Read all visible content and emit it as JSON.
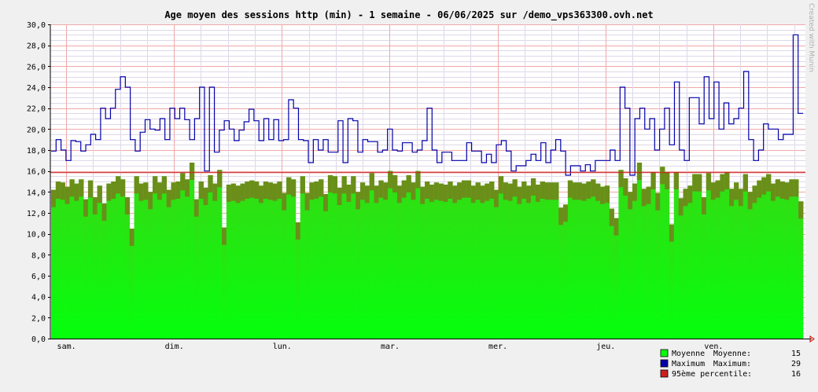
{
  "chart_data": {
    "type": "bar",
    "title": "Age moyen des sessions http (min) - 1 semaine - 06/06/2025 sur /demo_vps363300.ovh.net",
    "watermark": "Created with Munin",
    "xlabel": "",
    "ylabel": "",
    "ylim": [
      0,
      30
    ],
    "y_ticks": [
      "0,0",
      "2,0",
      "4,0",
      "6,0",
      "8,0",
      "10,0",
      "12,0",
      "14,0",
      "16,0",
      "18,0",
      "20,0",
      "22,0",
      "24,0",
      "26,0",
      "28,0",
      "30,0"
    ],
    "x_day_labels": [
      "sam.",
      "dim.",
      "lun.",
      "mar.",
      "mer.",
      "jeu.",
      "ven."
    ],
    "grid": true,
    "colors": {
      "background": "#f0f0f0",
      "plot_background": "#ffffff",
      "grid_minor": "#ded8e8",
      "grid_major": "#f0a8a8",
      "bar_top": "#6b8e1a",
      "bar_gradient_top": "#34dc14",
      "bar_gradient_bottom": "#04ff0c",
      "max_line": "#0000aa",
      "percentile_line": "#cc2020",
      "axis_arrow": "#cc0000"
    },
    "series": [
      {
        "name": "Moyenne",
        "values": [
          14.2,
          15.0,
          14.9,
          14.5,
          15.2,
          14.8,
          15.2,
          13.3,
          15.1,
          13.5,
          14.6,
          12.9,
          14.8,
          15.0,
          15.5,
          15.2,
          13.5,
          10.5,
          15.5,
          14.8,
          14.9,
          14.0,
          15.5,
          14.9,
          15.5,
          14.2,
          14.9,
          15.0,
          15.8,
          15.2,
          16.8,
          13.3,
          15.0,
          14.4,
          15.6,
          14.8,
          16.1,
          10.6,
          14.7,
          14.8,
          14.6,
          14.8,
          15.0,
          15.1,
          15.0,
          14.6,
          15.0,
          14.9,
          14.8,
          15.0,
          13.9,
          15.4,
          15.2,
          11.1,
          15.5,
          13.9,
          14.9,
          15.0,
          15.2,
          13.8,
          15.6,
          15.5,
          14.4,
          15.5,
          14.7,
          15.5,
          14.0,
          14.9,
          14.6,
          15.8,
          14.6,
          15.1,
          14.9,
          16.0,
          15.6,
          14.6,
          15.1,
          15.6,
          14.9,
          16.0,
          14.5,
          15.0,
          14.7,
          14.9,
          14.8,
          14.7,
          15.0,
          14.6,
          14.9,
          15.1,
          15.1,
          14.6,
          14.9,
          14.6,
          14.8,
          15.0,
          14.2,
          15.5,
          14.9,
          14.8,
          15.2,
          14.5,
          15.0,
          14.6,
          15.3,
          14.7,
          15.0,
          14.9,
          14.9,
          14.9,
          12.5,
          12.8,
          15.1,
          14.9,
          14.9,
          14.8,
          15.0,
          15.2,
          14.8,
          14.5,
          14.6,
          12.4,
          11.5,
          16.1,
          15.3,
          14.0,
          14.8,
          16.8,
          14.3,
          14.5,
          15.9,
          13.9,
          16.4,
          15.9,
          10.9,
          15.9,
          13.4,
          14.3,
          14.6,
          15.7,
          15.7,
          13.5,
          15.8,
          14.9,
          15.1,
          15.7,
          15.9,
          14.3,
          14.9,
          14.3,
          15.7,
          14.0,
          14.6,
          15.1,
          15.4,
          15.7,
          14.8,
          15.2,
          15.0,
          14.9,
          15.2,
          15.2,
          13.1
        ],
        "color": "#04ff0c"
      },
      {
        "name": "Maximum",
        "values": [
          17.9,
          19.0,
          18.0,
          17.0,
          18.9,
          18.8,
          17.9,
          18.5,
          19.5,
          19.0,
          22.0,
          21.0,
          22.0,
          23.8,
          25.0,
          24.0,
          19.0,
          17.9,
          19.7,
          20.9,
          20.0,
          19.9,
          21.0,
          19.0,
          22.0,
          21.0,
          22.0,
          20.9,
          19.0,
          21.0,
          24.0,
          16.0,
          24.0,
          17.8,
          19.9,
          20.8,
          20.0,
          18.9,
          19.9,
          20.7,
          21.9,
          20.8,
          18.9,
          21.0,
          19.0,
          20.9,
          18.9,
          19.0,
          22.8,
          22.0,
          19.0,
          18.9,
          16.8,
          19.0,
          18.0,
          19.0,
          17.8,
          17.8,
          20.8,
          16.8,
          21.0,
          20.8,
          17.8,
          19.0,
          18.8,
          18.8,
          17.8,
          18.0,
          20.0,
          18.0,
          17.9,
          18.7,
          18.7,
          17.8,
          18.0,
          18.9,
          22.0,
          18.0,
          16.8,
          17.8,
          17.8,
          17.0,
          17.0,
          17.0,
          18.7,
          17.9,
          17.9,
          16.8,
          17.6,
          16.8,
          18.5,
          18.9,
          17.9,
          16.0,
          16.5,
          16.5,
          17.0,
          17.6,
          17.0,
          18.7,
          16.8,
          18.0,
          19.0,
          17.9,
          15.6,
          16.5,
          16.5,
          16.0,
          16.6,
          16.0,
          17.0,
          17.0,
          17.0,
          18.0,
          17.0,
          24.0,
          22.0,
          15.6,
          21.0,
          22.0,
          20.0,
          21.0,
          18.0,
          20.0,
          22.0,
          18.5,
          24.5,
          18.0,
          17.0,
          23.0,
          23.0,
          20.5,
          25.0,
          21.0,
          24.5,
          20.0,
          22.5,
          20.5,
          21.0,
          22.0,
          25.5,
          19.0,
          17.0,
          18.0,
          20.5,
          20.0,
          20.0,
          19.0,
          19.5,
          19.5,
          29.0,
          21.5
        ],
        "color": "#0000aa"
      },
      {
        "name": "95ème percentile",
        "values": [
          15.85
        ],
        "color": "#cc2020"
      }
    ],
    "legend": {
      "placement": "bottom-right",
      "entries": [
        {
          "label": "Moyenne",
          "stat": "Moyenne:",
          "value": "15",
          "color": "#04ff0c"
        },
        {
          "label": "Maximum",
          "stat": "Maximum:",
          "value": "29",
          "color": "#0000aa"
        },
        {
          "label": "95ème percentile",
          "stat": ":",
          "value": "16",
          "color": "#cc2020"
        }
      ]
    }
  }
}
